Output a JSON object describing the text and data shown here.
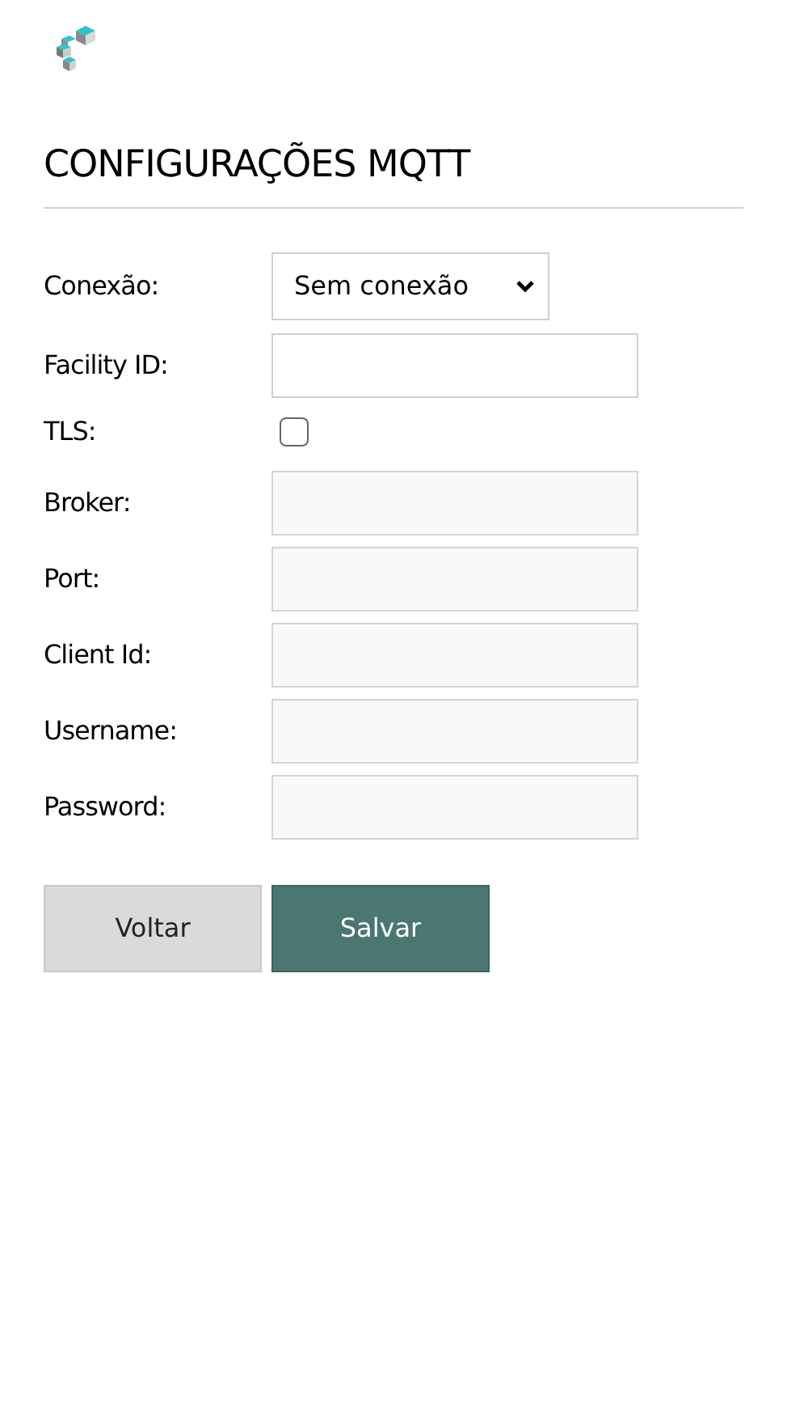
{
  "title": "CONFIGURAÇÕES MQTT",
  "fields": [
    {
      "kind": "select",
      "label": "Conexão:",
      "value": "Sem conexão"
    },
    {
      "kind": "text",
      "label": "Facility ID:"
    },
    {
      "kind": "checkbox",
      "label": "TLS:",
      "checked": false
    },
    {
      "kind": "locked",
      "label": "Broker:"
    },
    {
      "kind": "locked",
      "label": "Port:"
    },
    {
      "kind": "locked",
      "label": "Client Id:"
    },
    {
      "kind": "locked",
      "label": "Username:"
    },
    {
      "kind": "locked",
      "label": "Password:"
    }
  ],
  "buttons": [
    {
      "label": "Voltar",
      "kind": "secondary"
    },
    {
      "label": "Salvar",
      "kind": "primary"
    }
  ]
}
